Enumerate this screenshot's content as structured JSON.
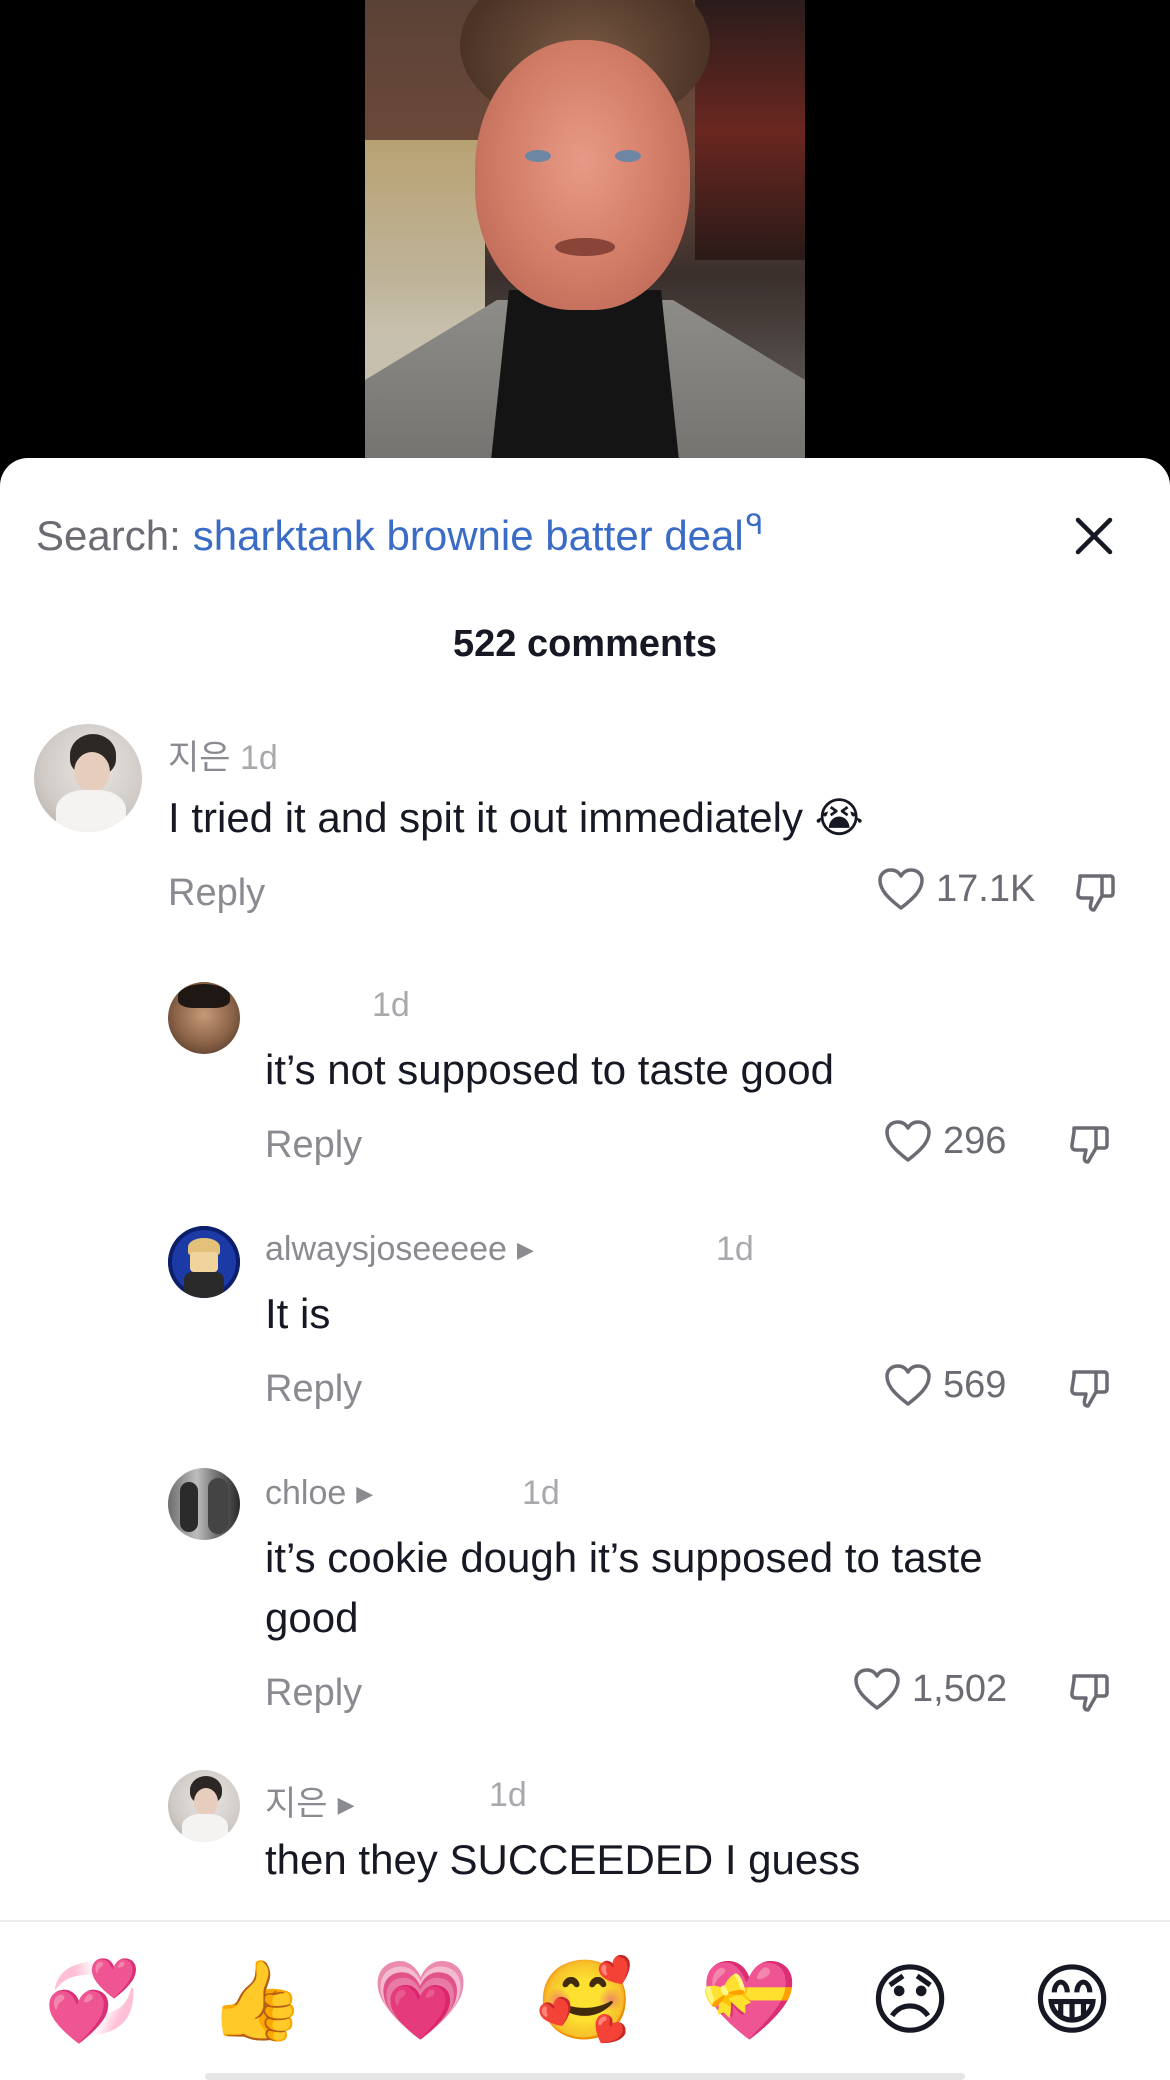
{
  "search": {
    "label": "Search:",
    "query": "sharktank brownie batter deal",
    "query_icon": "ᑫ"
  },
  "comments_header": "522 comments",
  "comments": [
    {
      "username": "지은",
      "time": "1d",
      "text": "I tried it and spit it out immediately",
      "emoji": "😭",
      "reply_label": "Reply",
      "likes": "17.1K"
    }
  ],
  "replies": [
    {
      "username": "",
      "time": "1d",
      "text": "it’s not supposed to taste good",
      "reply_label": "Reply",
      "likes": "296"
    },
    {
      "username": "alwaysjoseeeee",
      "time": "1d",
      "text": "It is",
      "reply_label": "Reply",
      "likes": "569"
    },
    {
      "username": "chloe",
      "time": "1d",
      "text_line1": "it’s cookie dough it’s supposed to taste",
      "text_line2": "good",
      "reply_label": "Reply",
      "likes": "1,502"
    },
    {
      "username": "지은",
      "time": "1d",
      "text": "then they SUCCEEDED I guess"
    }
  ],
  "emoji_bar": [
    "💞",
    "👍",
    "💗",
    "🥰",
    "💝",
    "😞",
    "😁"
  ],
  "colors": {
    "search_query": "#3a6bc7",
    "text_primary": "#161823",
    "text_secondary": "#8a8b91",
    "sheet_bg": "#ffffff"
  },
  "icons": {
    "close": "close-icon",
    "like": "heart-outline-icon",
    "dislike": "thumbs-down-outline-icon",
    "expand": "triangle-right-icon"
  }
}
